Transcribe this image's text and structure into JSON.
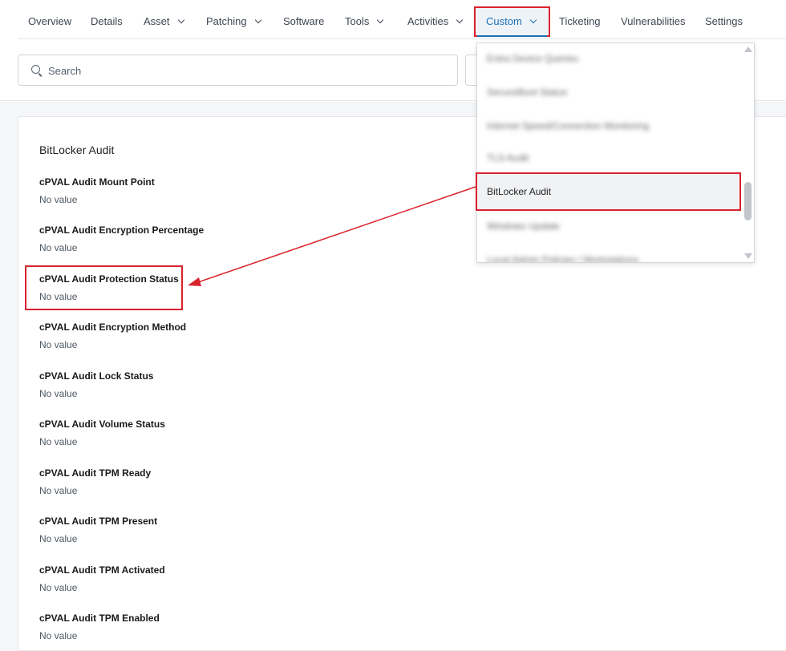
{
  "nav": {
    "tabs": [
      {
        "label": "Overview"
      },
      {
        "label": "Details"
      },
      {
        "label": "Asset"
      },
      {
        "label": "Patching"
      },
      {
        "label": "Software"
      },
      {
        "label": "Tools"
      },
      {
        "label": "Activities"
      },
      {
        "label": "Custom"
      },
      {
        "label": "Ticketing"
      },
      {
        "label": "Vulnerabilities"
      },
      {
        "label": "Settings"
      }
    ]
  },
  "search": {
    "placeholder": "Search"
  },
  "dropdown": {
    "items": [
      {
        "label": "Entra Device Queries"
      },
      {
        "label": "SecureBoot Status"
      },
      {
        "label": "Internet Speed/Connection Monitoring"
      },
      {
        "label": "TLS Audit"
      },
      {
        "label": "BitLocker Audit"
      },
      {
        "label": "Windows Update"
      },
      {
        "label": "Local Admin Policies / Workstations"
      }
    ]
  },
  "card": {
    "title": "BitLocker Audit",
    "fields": [
      {
        "label": "cPVAL Audit Mount Point",
        "value": "No value"
      },
      {
        "label": "cPVAL Audit Encryption Percentage",
        "value": "No value"
      },
      {
        "label": "cPVAL Audit Protection Status",
        "value": "No value"
      },
      {
        "label": "cPVAL Audit Encryption Method",
        "value": "No value"
      },
      {
        "label": "cPVAL Audit Lock Status",
        "value": "No value"
      },
      {
        "label": "cPVAL Audit Volume Status",
        "value": "No value"
      },
      {
        "label": "cPVAL Audit TPM Ready",
        "value": "No value"
      },
      {
        "label": "cPVAL Audit TPM Present",
        "value": "No value"
      },
      {
        "label": "cPVAL Audit TPM Activated",
        "value": "No value"
      },
      {
        "label": "cPVAL Audit TPM Enabled",
        "value": "No value"
      }
    ]
  },
  "colors": {
    "accent": "#1f6fb5",
    "annotation": "#d9232d"
  }
}
